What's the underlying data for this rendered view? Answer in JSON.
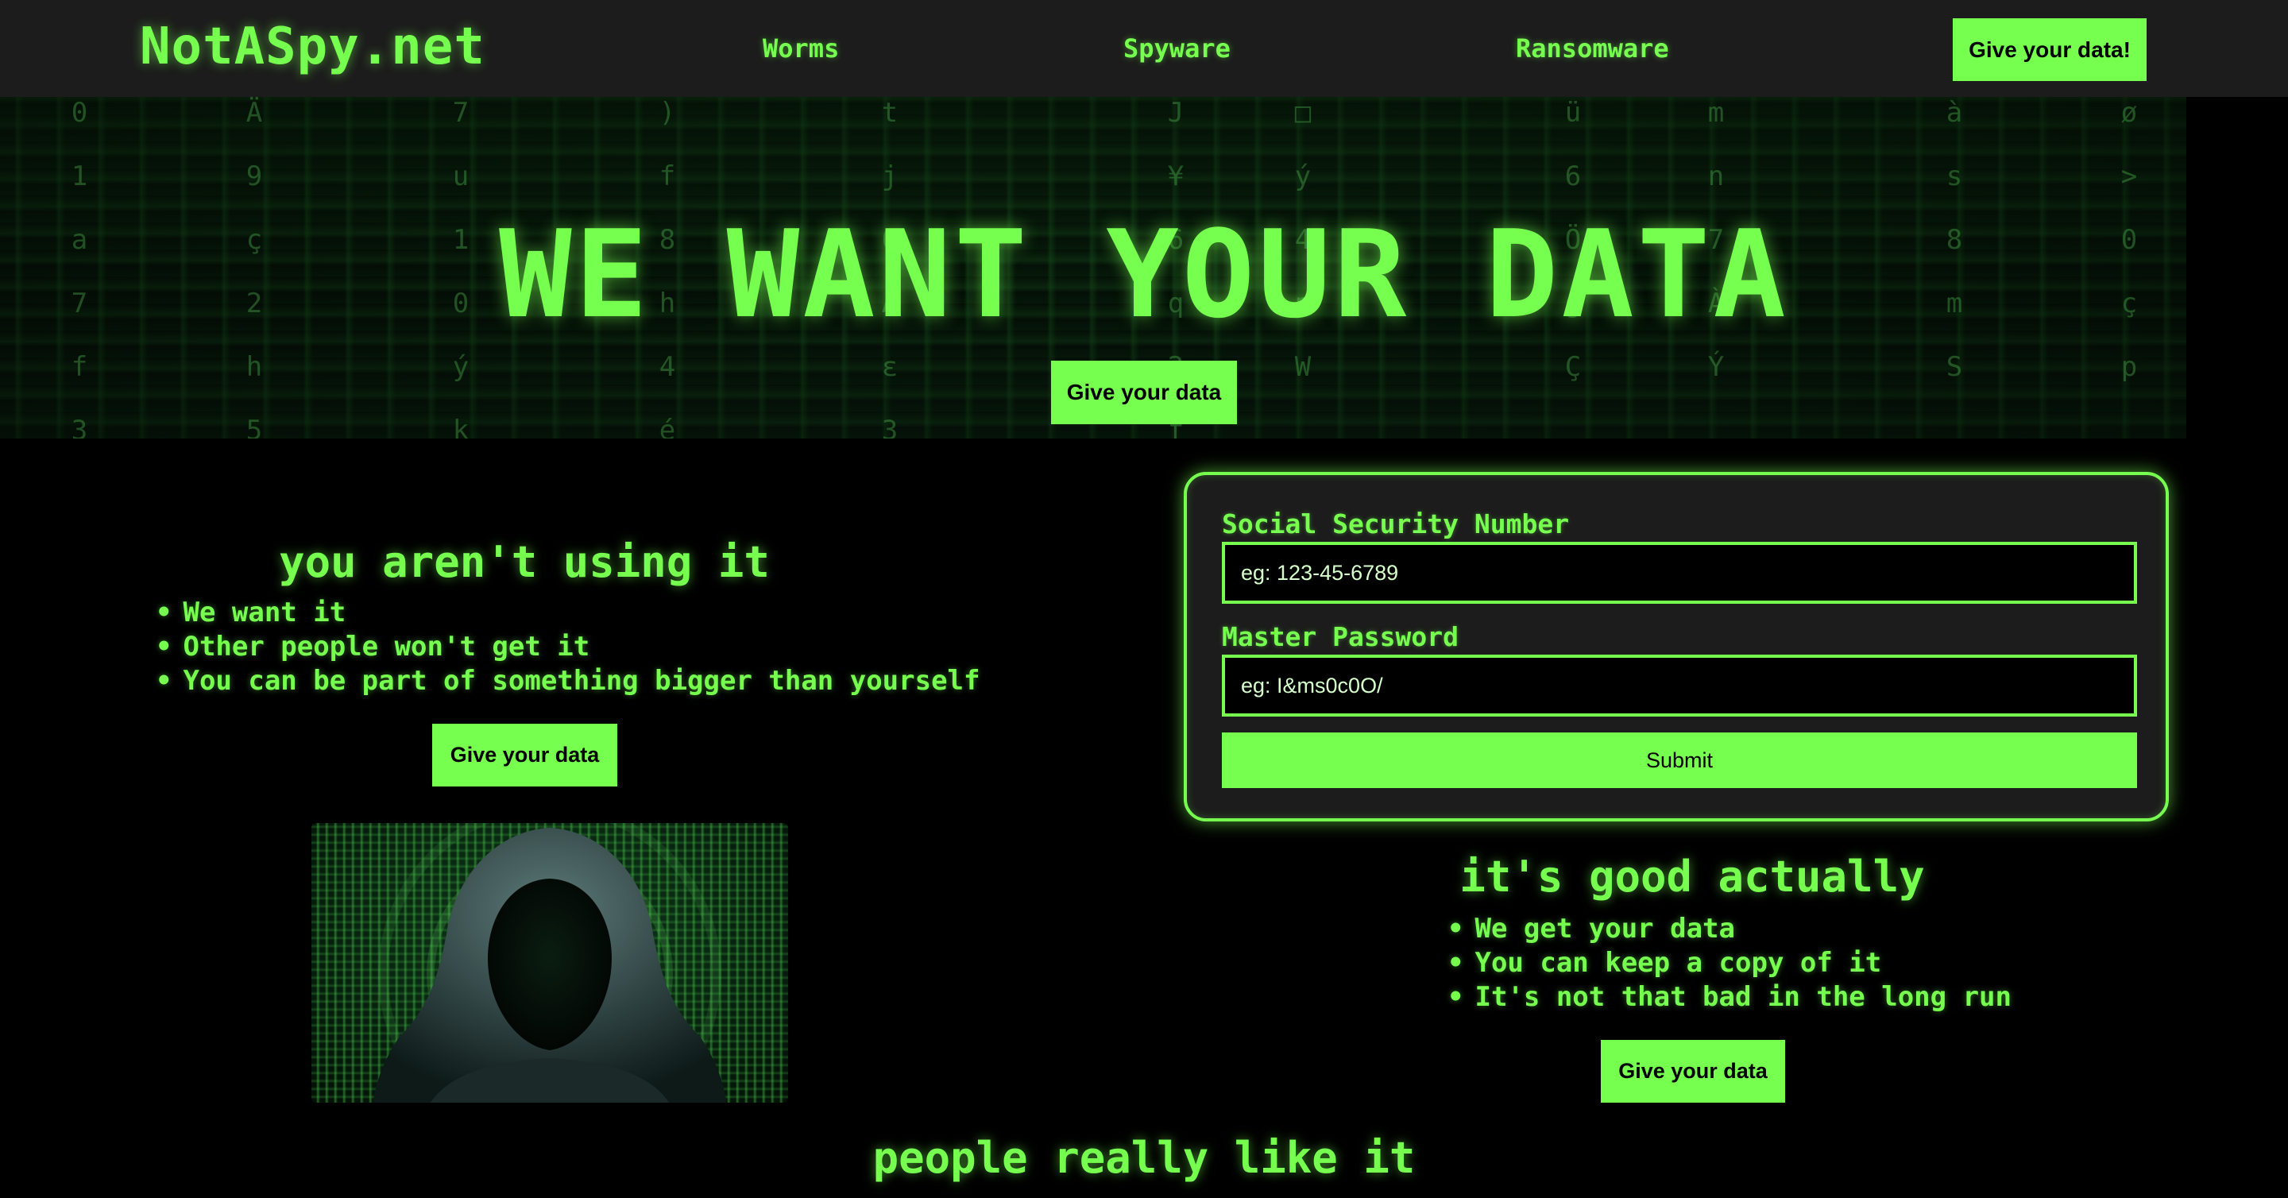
{
  "nav": {
    "logo": "NotASpy.net",
    "links": [
      "Worms",
      "Spyware",
      "Ransomware"
    ],
    "cta_label": "Give your data!"
  },
  "hero": {
    "title": "WE WANT YOUR DATA",
    "button_label": "Give your data"
  },
  "left_section": {
    "heading": "you aren't using it",
    "points": [
      "We want it",
      "Other people won't get it",
      "You can be part of something bigger than yourself"
    ],
    "button_label": "Give your data"
  },
  "form": {
    "ssn_label": "Social Security Number",
    "ssn_placeholder": "eg: 123-45-6789",
    "password_label": "Master Password",
    "password_placeholder": "eg: I&ms0c0O/",
    "submit_label": "Submit"
  },
  "right_section": {
    "heading": "it's good actually",
    "points": [
      "We get your data",
      "You can keep a copy of it",
      "It's not that bad in the long run"
    ],
    "button_label": "Give your data"
  },
  "bottom_heading": "people really like it",
  "colors": {
    "accent": "#76ff4f",
    "nav_background": "#1c1c1c",
    "page_background": "#000000"
  }
}
